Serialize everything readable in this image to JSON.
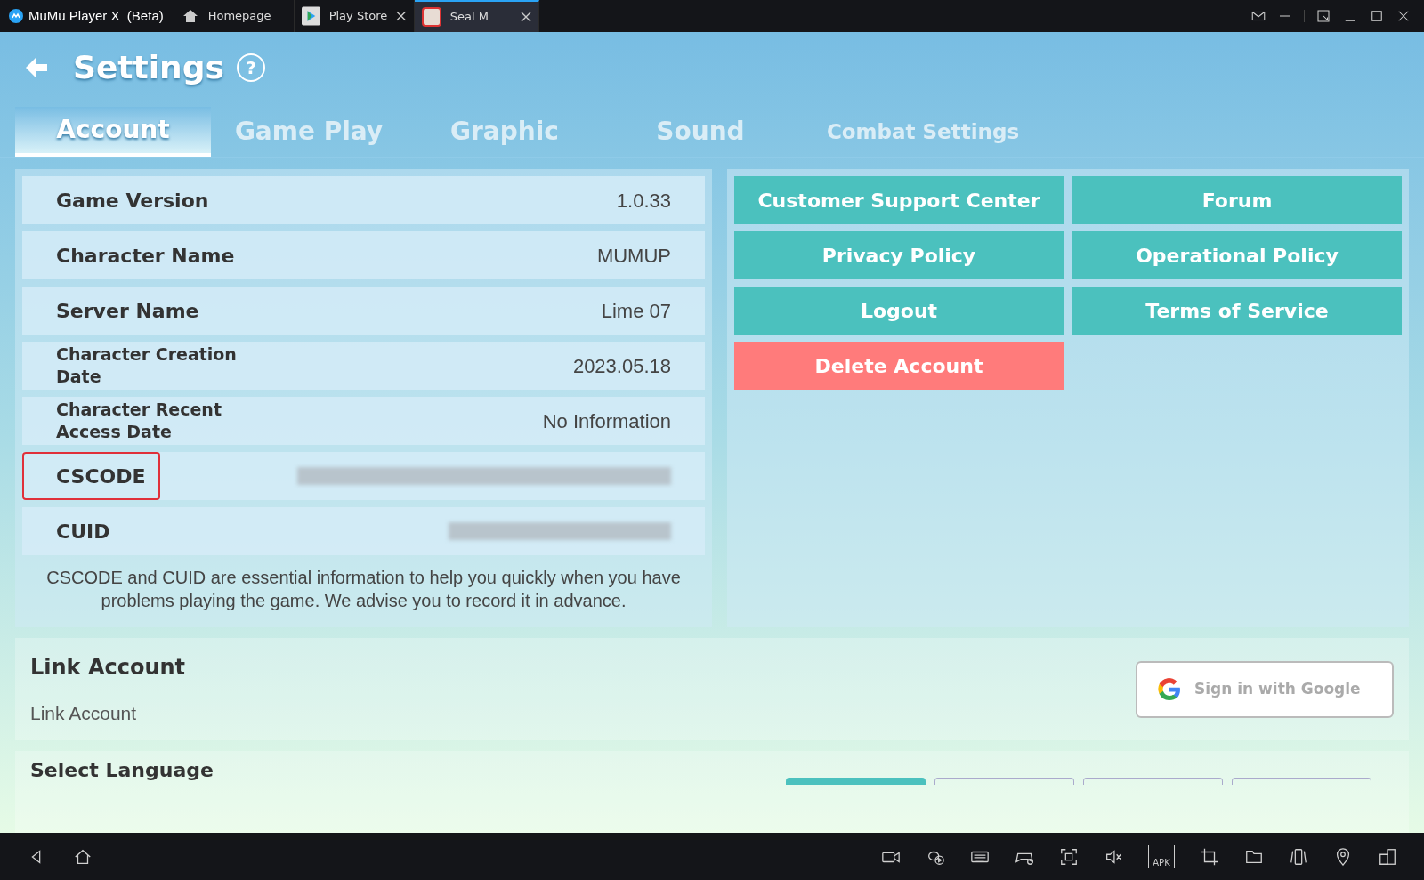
{
  "title_bar": {
    "app_name": "MuMu Player X  (Beta)",
    "tabs": [
      {
        "label": "Homepage",
        "kind": "home",
        "selected": false,
        "closable": false
      },
      {
        "label": "Play Store",
        "kind": "store",
        "selected": false,
        "closable": true
      },
      {
        "label": "Seal M",
        "kind": "game",
        "selected": true,
        "closable": true
      }
    ]
  },
  "header": {
    "title": "Settings",
    "help": "?"
  },
  "tabs": [
    {
      "label": "Account",
      "selected": true
    },
    {
      "label": "Game Play",
      "selected": false
    },
    {
      "label": "Graphic",
      "selected": false
    },
    {
      "label": "Sound",
      "selected": false
    },
    {
      "label": "Combat Settings",
      "selected": false
    }
  ],
  "info_rows": [
    {
      "label": "Game Version",
      "value": "1.0.33",
      "highlighted": false
    },
    {
      "label": "Character Name",
      "value": "MUMUP",
      "highlighted": false
    },
    {
      "label": "Server Name",
      "value": "Lime 07",
      "highlighted": false
    },
    {
      "label": "Character Creation Date",
      "value": "2023.05.18",
      "highlighted": false
    },
    {
      "label": "Character Recent Access Date",
      "value": "No Information",
      "highlighted": false
    },
    {
      "label": "CSCODE",
      "kind": "blurred",
      "highlighted": true
    },
    {
      "label": "CUID",
      "kind": "blurred",
      "highlighted": false
    }
  ],
  "note": "CSCODE and CUID are essential information to help you quickly when you have problems playing the game. We advise you to record it in advance.",
  "buttons": [
    {
      "label": "Customer Support Center",
      "kind": "normal"
    },
    {
      "label": "Forum",
      "kind": "normal"
    },
    {
      "label": "Privacy Policy",
      "kind": "normal"
    },
    {
      "label": "Operational Policy",
      "kind": "normal"
    },
    {
      "label": "Logout",
      "kind": "normal"
    },
    {
      "label": "Terms of Service",
      "kind": "normal"
    },
    {
      "label": "Delete Account",
      "kind": "danger"
    }
  ],
  "link_account": {
    "title": "Link Account",
    "subtitle": "Link Account",
    "google_button": "Sign in with Google"
  },
  "select_language": {
    "title": "Select Language",
    "options": [
      {
        "selected": true
      },
      {
        "selected": false
      },
      {
        "selected": false
      },
      {
        "selected": false
      }
    ]
  },
  "bottom_bar": {
    "apk_label": "APK"
  }
}
